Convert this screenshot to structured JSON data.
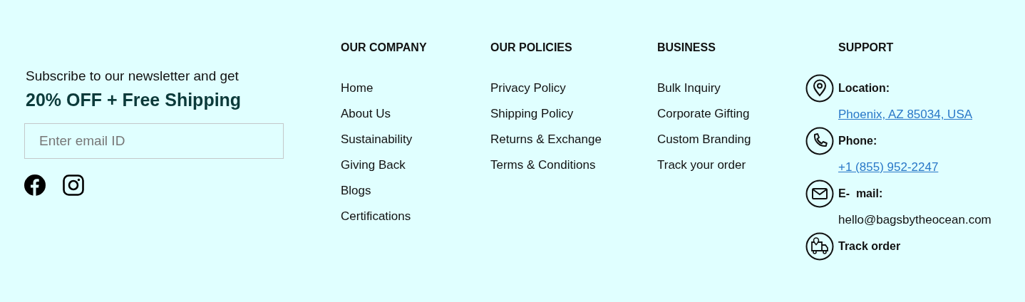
{
  "newsletter": {
    "text": "Subscribe to our newsletter and get",
    "offer": "20% OFF + Free Shipping",
    "email_field": {
      "placeholder": "Enter email ID"
    },
    "social": [
      {
        "kind": "facebook"
      },
      {
        "kind": "instagram"
      }
    ]
  },
  "columns": [
    {
      "heading": "OUR COMPANY",
      "links": [
        "Home",
        "About Us",
        "Sustainability",
        "Giving Back",
        "Blogs",
        "Certifications"
      ]
    },
    {
      "heading": "OUR POLICIES",
      "links": [
        "Privacy Policy",
        "Shipping Policy",
        "Returns & Exchange",
        "Terms & Conditions"
      ]
    },
    {
      "heading": "BUSINESS",
      "links": [
        "Bulk Inquiry",
        "Corporate Gifting",
        "Custom Branding",
        "Track your order"
      ]
    }
  ],
  "support": {
    "heading": "SUPPORT",
    "items": [
      {
        "kind": "location",
        "label": "Location:",
        "value": "Phoenix, AZ 85034, USA",
        "linked": true
      },
      {
        "kind": "phone",
        "label": "Phone:",
        "value": "+1 (855) 952-2247",
        "linked": true
      },
      {
        "kind": "email",
        "label": "E-  mail:",
        "value": "hello@bagsbytheocean.com",
        "linked": false
      },
      {
        "kind": "track",
        "label": "Track order"
      }
    ]
  }
}
